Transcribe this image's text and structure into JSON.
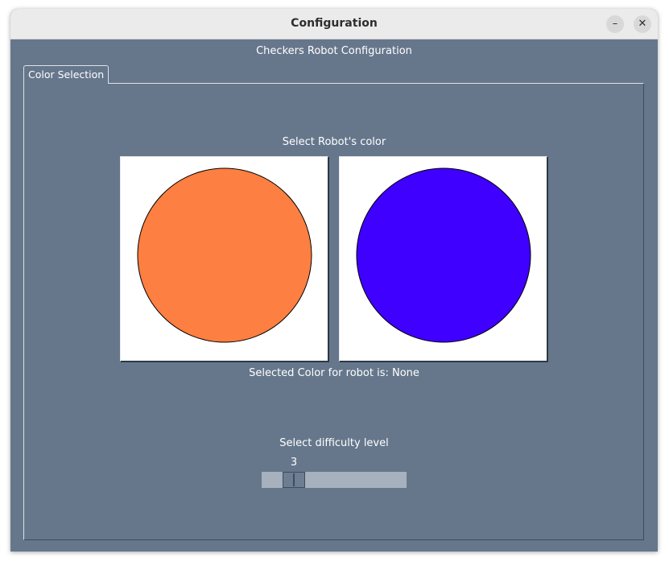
{
  "window": {
    "title": "Configuration",
    "minimize_glyph": "–",
    "close_glyph": "✕"
  },
  "header": {
    "label": "Checkers Robot Configuration"
  },
  "tabs": [
    {
      "label": "Color Selection",
      "selected": true
    }
  ],
  "color_selection": {
    "prompt": "Select Robot's color",
    "options": [
      {
        "name": "orange",
        "color": "#fd7f41"
      },
      {
        "name": "blue",
        "color": "#3f00ff"
      }
    ],
    "selected_text": "Selected Color for robot is: None"
  },
  "difficulty": {
    "prompt": "Select difficulty level",
    "value": "3",
    "value_number": 3,
    "min": 1,
    "max": 10
  },
  "colors": {
    "window_bg": "#66778c",
    "titlebar_bg": "#ebebeb",
    "slider_trough": "#a6b1bd"
  }
}
